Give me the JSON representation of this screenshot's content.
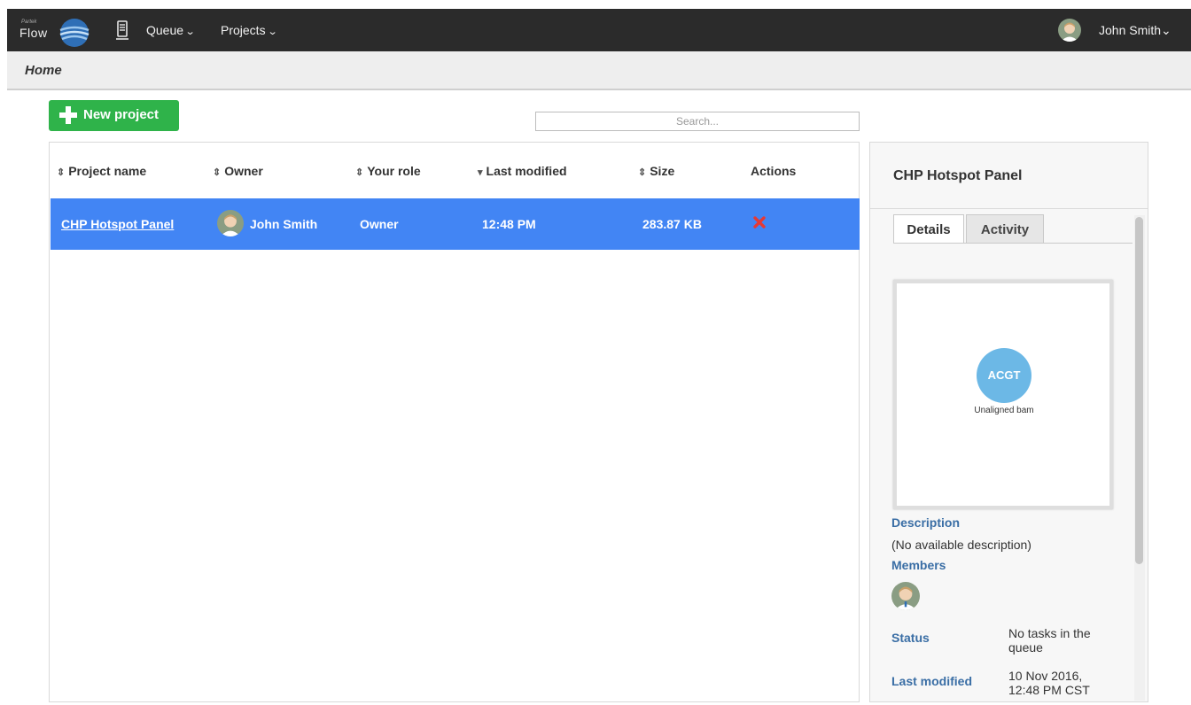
{
  "app": {
    "logo_small": "Partek",
    "logo_text": "Flow"
  },
  "nav": {
    "queue_label": "Queue",
    "projects_label": "Projects",
    "user_name": "John Smith"
  },
  "breadcrumb": {
    "current": "Home"
  },
  "toolbar": {
    "new_project_label": "New project",
    "search_placeholder": "Search..."
  },
  "table": {
    "columns": {
      "name": "Project name",
      "owner": "Owner",
      "role": "Your role",
      "modified": "Last modified",
      "size": "Size",
      "actions": "Actions"
    },
    "sort_icons": {
      "sortable": "⇕",
      "descending": "▾"
    },
    "rows": [
      {
        "name": "CHP Hotspot Panel",
        "owner": "John Smith",
        "role": "Owner",
        "modified": "12:48 PM",
        "size": "283.87 KB",
        "action_icon": "delete-icon"
      }
    ]
  },
  "detail": {
    "title": "CHP Hotspot Panel",
    "tabs": [
      "Details",
      "Activity"
    ],
    "active_tab": "Details",
    "file_label": "Unaligned bam",
    "file_icon_text": "ACGT",
    "description_label": "Description",
    "description_value": "(No available description)",
    "members_label": "Members",
    "status_label": "Status",
    "status_value": "No tasks in the queue",
    "last_modified_label": "Last modified",
    "last_modified_value": "10 Nov 2016, 12:48 PM CST"
  },
  "colors": {
    "topbar": "#2b2b2b",
    "accent_green": "#2fb34a",
    "selection_blue": "#4285f4",
    "link_blue": "#3a6ea5",
    "delete_red": "#e53935"
  }
}
